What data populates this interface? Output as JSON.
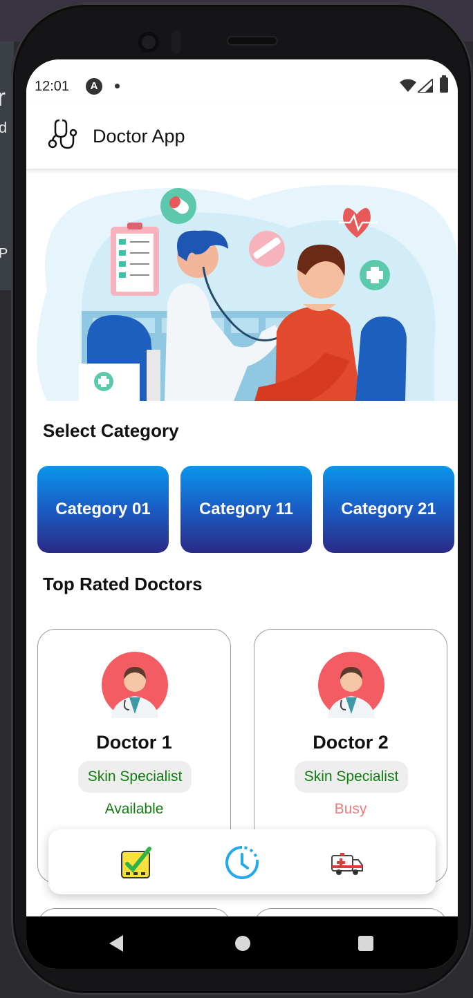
{
  "status_bar": {
    "time": "12:01",
    "app_indicator": "A"
  },
  "app_bar": {
    "title": "Doctor App",
    "logo_icon": "stethoscope-icon"
  },
  "sections": {
    "category_title": "Select Category",
    "doctors_title": "Top Rated Doctors"
  },
  "categories": [
    {
      "label": "Category 01"
    },
    {
      "label": "Category 11"
    },
    {
      "label": "Category 21"
    }
  ],
  "doctors": [
    {
      "name": "Doctor 1",
      "specialty": "Skin Specialist",
      "status": "Available",
      "status_color": "#0f7d0f"
    },
    {
      "name": "Doctor 2",
      "specialty": "Skin Specialist",
      "status": "Busy",
      "status_color": "#ef7b7b"
    }
  ],
  "bottom_nav": [
    {
      "icon": "checklist-icon"
    },
    {
      "icon": "clock-history-icon"
    },
    {
      "icon": "ambulance-icon"
    }
  ],
  "desktop_bg": {
    "left_char_1": "r",
    "left_char_2": "d",
    "left_char_3": "P"
  },
  "colors": {
    "accent_gradient_top": "#0a96ec",
    "accent_gradient_bottom": "#2b2a86",
    "available": "#0f7d0f",
    "busy": "#ef7b7b"
  }
}
